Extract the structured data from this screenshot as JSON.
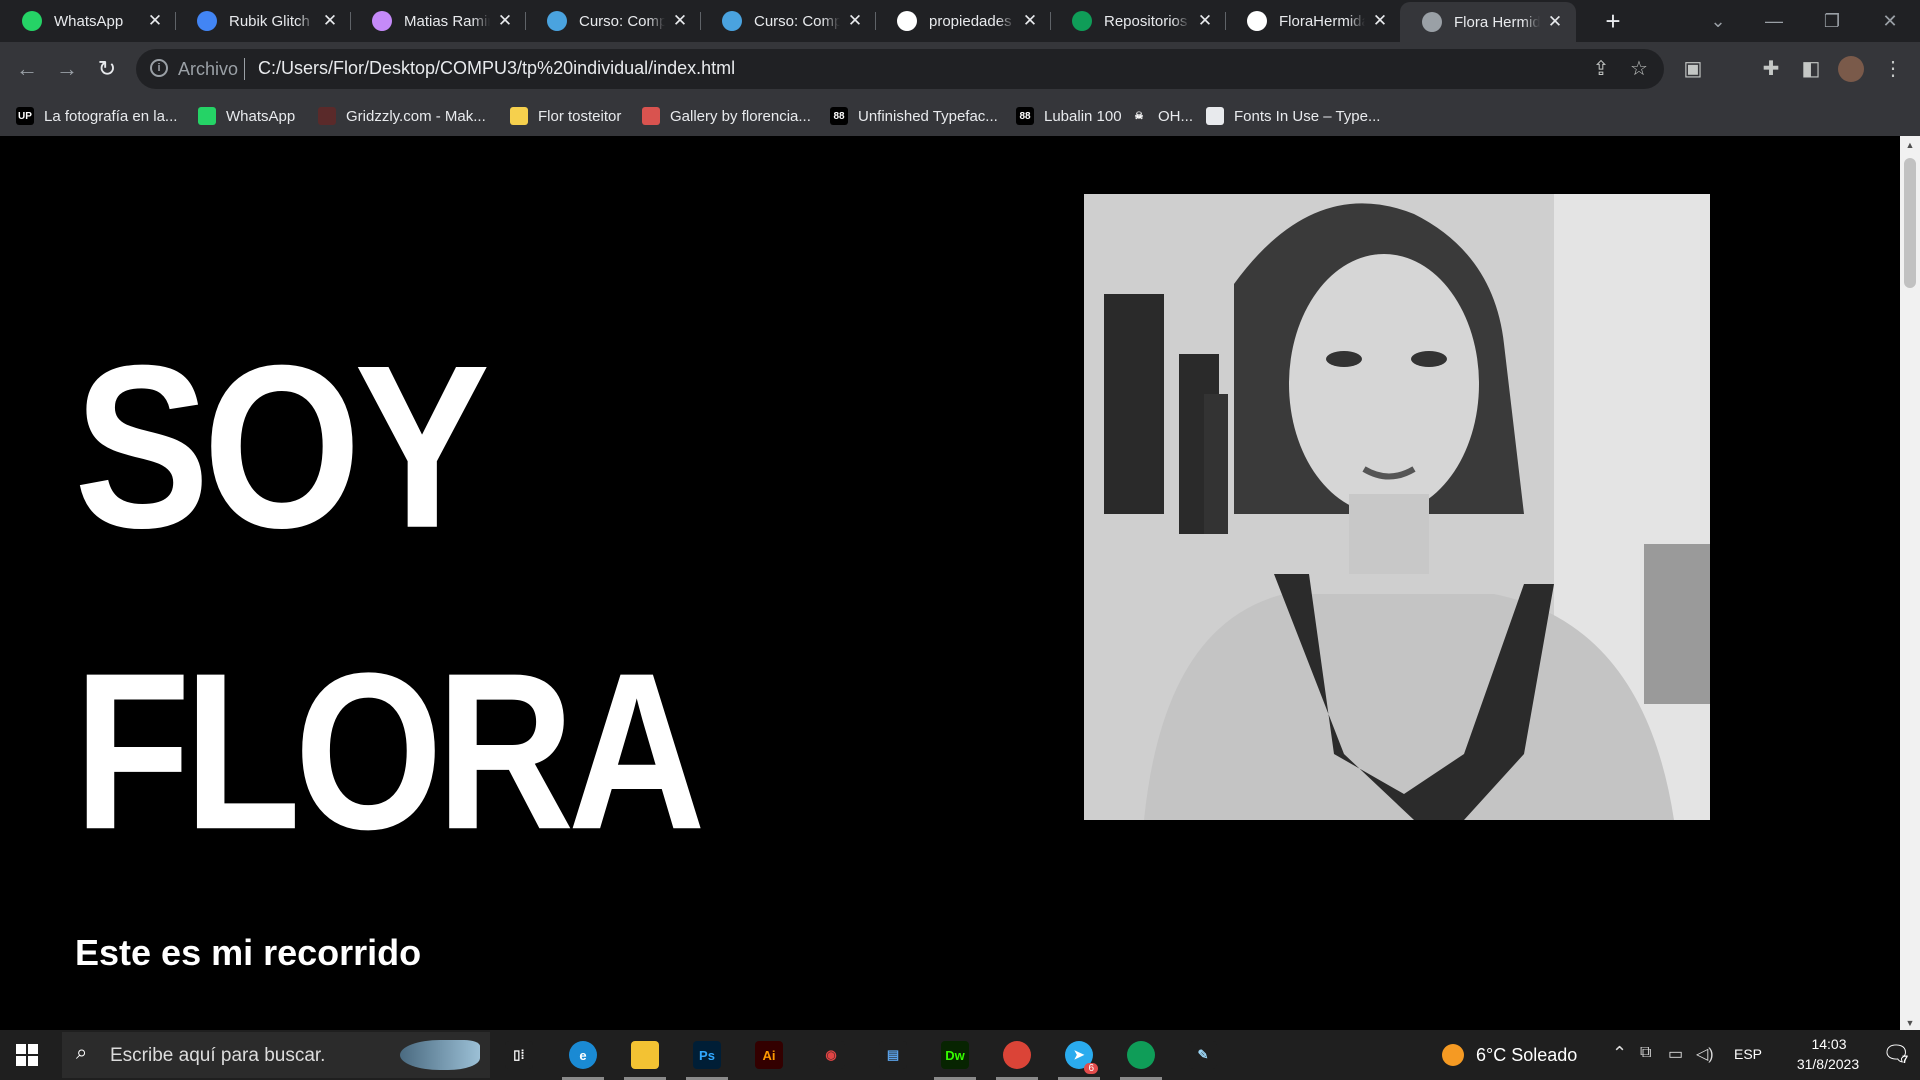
{
  "browser": {
    "tabs": [
      {
        "title": "WhatsApp",
        "favicon": "whatsapp-icon",
        "color": "#25d366"
      },
      {
        "title": "Rubik Glitch - Google Fonts",
        "favicon": "google-fonts-icon",
        "color": "#4285f4"
      },
      {
        "title": "Matias Ramirez",
        "favicon": "ai-icon",
        "color": "#c58af9"
      },
      {
        "title": "Curso: Computación",
        "favicon": "moodle-icon",
        "color": "#4aa3df"
      },
      {
        "title": "Curso: Computación",
        "favicon": "moodle-icon",
        "color": "#4aa3df"
      },
      {
        "title": "propiedades css",
        "favicon": "google-icon",
        "color": "#ffffff"
      },
      {
        "title": "Repositorios individuales",
        "favicon": "sheets-icon",
        "color": "#0f9d58"
      },
      {
        "title": "FloraHermida/",
        "favicon": "github-icon",
        "color": "#ffffff"
      },
      {
        "title": "Flora Hermida",
        "favicon": "globe-icon",
        "color": "#9aa0a6",
        "active": true
      }
    ],
    "new_tab_label": "+",
    "address": {
      "scheme": "Archivo",
      "url": "C:/Users/Flor/Desktop/COMPU3/tp%20individual/index.html"
    },
    "bookmarks": [
      {
        "label": "La fotografía en la...",
        "icon": "up-icon",
        "text": "UP",
        "color": "#000000"
      },
      {
        "label": "WhatsApp",
        "icon": "whatsapp-icon",
        "text": "",
        "color": "#25d366"
      },
      {
        "label": "Gridzzly.com - Mak...",
        "icon": "gridzzly-icon",
        "text": "",
        "color": "#5a2a2a"
      },
      {
        "label": "Flor tosteitor",
        "icon": "folder-icon",
        "text": "",
        "color": "#f6d04d"
      },
      {
        "label": "Gallery by florencia...",
        "icon": "shell-icon",
        "text": "",
        "color": "#d9534f"
      },
      {
        "label": "Unfinished Typefac...",
        "icon": "grid-icon",
        "text": "88",
        "color": "#000000"
      },
      {
        "label": "Lubalin 100",
        "icon": "grid-icon",
        "text": "88",
        "color": "#000000"
      },
      {
        "label": "OH...",
        "icon": "skull-icon",
        "text": "☠",
        "color": "#35363a"
      },
      {
        "label": "Fonts In Use – Type...",
        "icon": "fonts-in-use-icon",
        "text": "",
        "color": "#e8eaed"
      }
    ]
  },
  "page": {
    "hero_line1": "SOY",
    "hero_line2": "FLORA",
    "subtitle": "Este es mi recorrido",
    "photo": "portrait-photo"
  },
  "taskbar": {
    "search_placeholder": "Escribe aquí para buscar.",
    "apps": [
      {
        "name": "task-view",
        "label": "▯⁞",
        "color": "#1f1f1f",
        "fg": "#ffffff"
      },
      {
        "name": "edge",
        "label": "e",
        "color": "#1a8ad4",
        "fg": "#ffffff"
      },
      {
        "name": "file-explorer",
        "label": "",
        "color": "#f3c233",
        "fg": "#000000"
      },
      {
        "name": "photoshop",
        "label": "Ps",
        "color": "#001e36",
        "fg": "#31a8ff"
      },
      {
        "name": "illustrator",
        "label": "Ai",
        "color": "#330000",
        "fg": "#ff9a00"
      },
      {
        "name": "davinci",
        "label": "◉",
        "color": "#1f1f1f",
        "fg": "#e04444"
      },
      {
        "name": "notepad-app",
        "label": "▤",
        "color": "#1f1f1f",
        "fg": "#5aa0e6"
      },
      {
        "name": "dreamweaver",
        "label": "Dw",
        "color": "#072401",
        "fg": "#35fa00"
      },
      {
        "name": "chrome-profile",
        "label": "",
        "color": "#db4437",
        "fg": "#ffffff"
      },
      {
        "name": "telegram",
        "label": "➤",
        "color": "#2aabee",
        "fg": "#ffffff",
        "badge": "6"
      },
      {
        "name": "chrome",
        "label": "",
        "color": "#0f9d58",
        "fg": "#ffffff"
      },
      {
        "name": "snip-tool",
        "label": "✎",
        "color": "#1f1f1f",
        "fg": "#9ad3f2"
      }
    ],
    "weather": "6°C  Soleado",
    "lang": "ESP",
    "time": "14:03",
    "date": "31/8/2023",
    "notifications": "7"
  }
}
